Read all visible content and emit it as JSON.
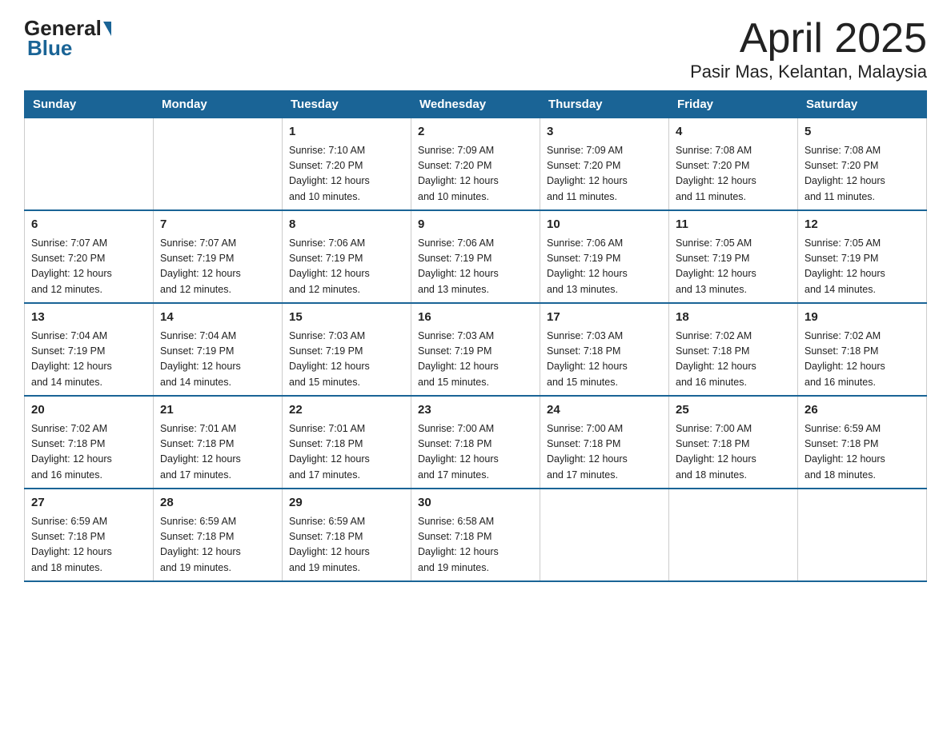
{
  "header": {
    "logo_general": "General",
    "logo_blue": "Blue",
    "title": "April 2025",
    "subtitle": "Pasir Mas, Kelantan, Malaysia"
  },
  "days_of_week": [
    "Sunday",
    "Monday",
    "Tuesday",
    "Wednesday",
    "Thursday",
    "Friday",
    "Saturday"
  ],
  "weeks": [
    [
      {
        "day": "",
        "info": ""
      },
      {
        "day": "",
        "info": ""
      },
      {
        "day": "1",
        "info": "Sunrise: 7:10 AM\nSunset: 7:20 PM\nDaylight: 12 hours\nand 10 minutes."
      },
      {
        "day": "2",
        "info": "Sunrise: 7:09 AM\nSunset: 7:20 PM\nDaylight: 12 hours\nand 10 minutes."
      },
      {
        "day": "3",
        "info": "Sunrise: 7:09 AM\nSunset: 7:20 PM\nDaylight: 12 hours\nand 11 minutes."
      },
      {
        "day": "4",
        "info": "Sunrise: 7:08 AM\nSunset: 7:20 PM\nDaylight: 12 hours\nand 11 minutes."
      },
      {
        "day": "5",
        "info": "Sunrise: 7:08 AM\nSunset: 7:20 PM\nDaylight: 12 hours\nand 11 minutes."
      }
    ],
    [
      {
        "day": "6",
        "info": "Sunrise: 7:07 AM\nSunset: 7:20 PM\nDaylight: 12 hours\nand 12 minutes."
      },
      {
        "day": "7",
        "info": "Sunrise: 7:07 AM\nSunset: 7:19 PM\nDaylight: 12 hours\nand 12 minutes."
      },
      {
        "day": "8",
        "info": "Sunrise: 7:06 AM\nSunset: 7:19 PM\nDaylight: 12 hours\nand 12 minutes."
      },
      {
        "day": "9",
        "info": "Sunrise: 7:06 AM\nSunset: 7:19 PM\nDaylight: 12 hours\nand 13 minutes."
      },
      {
        "day": "10",
        "info": "Sunrise: 7:06 AM\nSunset: 7:19 PM\nDaylight: 12 hours\nand 13 minutes."
      },
      {
        "day": "11",
        "info": "Sunrise: 7:05 AM\nSunset: 7:19 PM\nDaylight: 12 hours\nand 13 minutes."
      },
      {
        "day": "12",
        "info": "Sunrise: 7:05 AM\nSunset: 7:19 PM\nDaylight: 12 hours\nand 14 minutes."
      }
    ],
    [
      {
        "day": "13",
        "info": "Sunrise: 7:04 AM\nSunset: 7:19 PM\nDaylight: 12 hours\nand 14 minutes."
      },
      {
        "day": "14",
        "info": "Sunrise: 7:04 AM\nSunset: 7:19 PM\nDaylight: 12 hours\nand 14 minutes."
      },
      {
        "day": "15",
        "info": "Sunrise: 7:03 AM\nSunset: 7:19 PM\nDaylight: 12 hours\nand 15 minutes."
      },
      {
        "day": "16",
        "info": "Sunrise: 7:03 AM\nSunset: 7:19 PM\nDaylight: 12 hours\nand 15 minutes."
      },
      {
        "day": "17",
        "info": "Sunrise: 7:03 AM\nSunset: 7:18 PM\nDaylight: 12 hours\nand 15 minutes."
      },
      {
        "day": "18",
        "info": "Sunrise: 7:02 AM\nSunset: 7:18 PM\nDaylight: 12 hours\nand 16 minutes."
      },
      {
        "day": "19",
        "info": "Sunrise: 7:02 AM\nSunset: 7:18 PM\nDaylight: 12 hours\nand 16 minutes."
      }
    ],
    [
      {
        "day": "20",
        "info": "Sunrise: 7:02 AM\nSunset: 7:18 PM\nDaylight: 12 hours\nand 16 minutes."
      },
      {
        "day": "21",
        "info": "Sunrise: 7:01 AM\nSunset: 7:18 PM\nDaylight: 12 hours\nand 17 minutes."
      },
      {
        "day": "22",
        "info": "Sunrise: 7:01 AM\nSunset: 7:18 PM\nDaylight: 12 hours\nand 17 minutes."
      },
      {
        "day": "23",
        "info": "Sunrise: 7:00 AM\nSunset: 7:18 PM\nDaylight: 12 hours\nand 17 minutes."
      },
      {
        "day": "24",
        "info": "Sunrise: 7:00 AM\nSunset: 7:18 PM\nDaylight: 12 hours\nand 17 minutes."
      },
      {
        "day": "25",
        "info": "Sunrise: 7:00 AM\nSunset: 7:18 PM\nDaylight: 12 hours\nand 18 minutes."
      },
      {
        "day": "26",
        "info": "Sunrise: 6:59 AM\nSunset: 7:18 PM\nDaylight: 12 hours\nand 18 minutes."
      }
    ],
    [
      {
        "day": "27",
        "info": "Sunrise: 6:59 AM\nSunset: 7:18 PM\nDaylight: 12 hours\nand 18 minutes."
      },
      {
        "day": "28",
        "info": "Sunrise: 6:59 AM\nSunset: 7:18 PM\nDaylight: 12 hours\nand 19 minutes."
      },
      {
        "day": "29",
        "info": "Sunrise: 6:59 AM\nSunset: 7:18 PM\nDaylight: 12 hours\nand 19 minutes."
      },
      {
        "day": "30",
        "info": "Sunrise: 6:58 AM\nSunset: 7:18 PM\nDaylight: 12 hours\nand 19 minutes."
      },
      {
        "day": "",
        "info": ""
      },
      {
        "day": "",
        "info": ""
      },
      {
        "day": "",
        "info": ""
      }
    ]
  ]
}
